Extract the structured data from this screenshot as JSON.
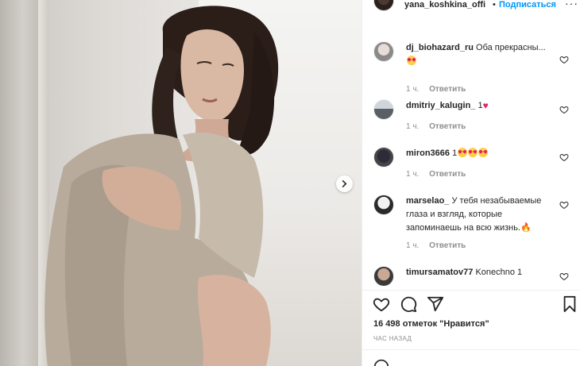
{
  "header": {
    "username": "yana_koshkina_offi",
    "separator": "•",
    "follow_label": "Подписаться",
    "more_label": "···"
  },
  "photo": {
    "next_icon": "chevron-right-icon"
  },
  "comments": [
    {
      "username": "dj_biohazard_ru",
      "text": "Оба прекрасны...",
      "emoji": [
        "heart-eyes"
      ],
      "time": "1 ч.",
      "reply": "Ответить"
    },
    {
      "username": "dmitriy_kalugin_",
      "text": "1",
      "emoji": [
        "red-heart"
      ],
      "time": "1 ч.",
      "reply": "Ответить"
    },
    {
      "username": "miron3666",
      "text": "1",
      "emoji": [
        "heart-eyes",
        "heart-eyes",
        "heart-eyes"
      ],
      "time": "1 ч.",
      "reply": "Ответить"
    },
    {
      "username": "marselao_",
      "text": "У тебя незабываемые глаза и взгляд, которые запоминаешь на всю жизнь.",
      "emoji": [
        "fire"
      ],
      "time": "1 ч.",
      "reply": "Ответить"
    },
    {
      "username": "timursamatov77",
      "text": "Konechno 1",
      "emoji": [],
      "time": "",
      "reply": ""
    }
  ],
  "actions": {
    "like_icon": "heart-outline-icon",
    "comment_icon": "comment-icon",
    "share_icon": "paper-plane-icon",
    "save_icon": "bookmark-icon"
  },
  "likes_text": "16 498 отметок \"Нравится\"",
  "time_ago": "час назад",
  "colors": {
    "link": "#0095f6",
    "text": "#262626",
    "muted": "#8e8e8e",
    "heart": "#e0245e"
  }
}
